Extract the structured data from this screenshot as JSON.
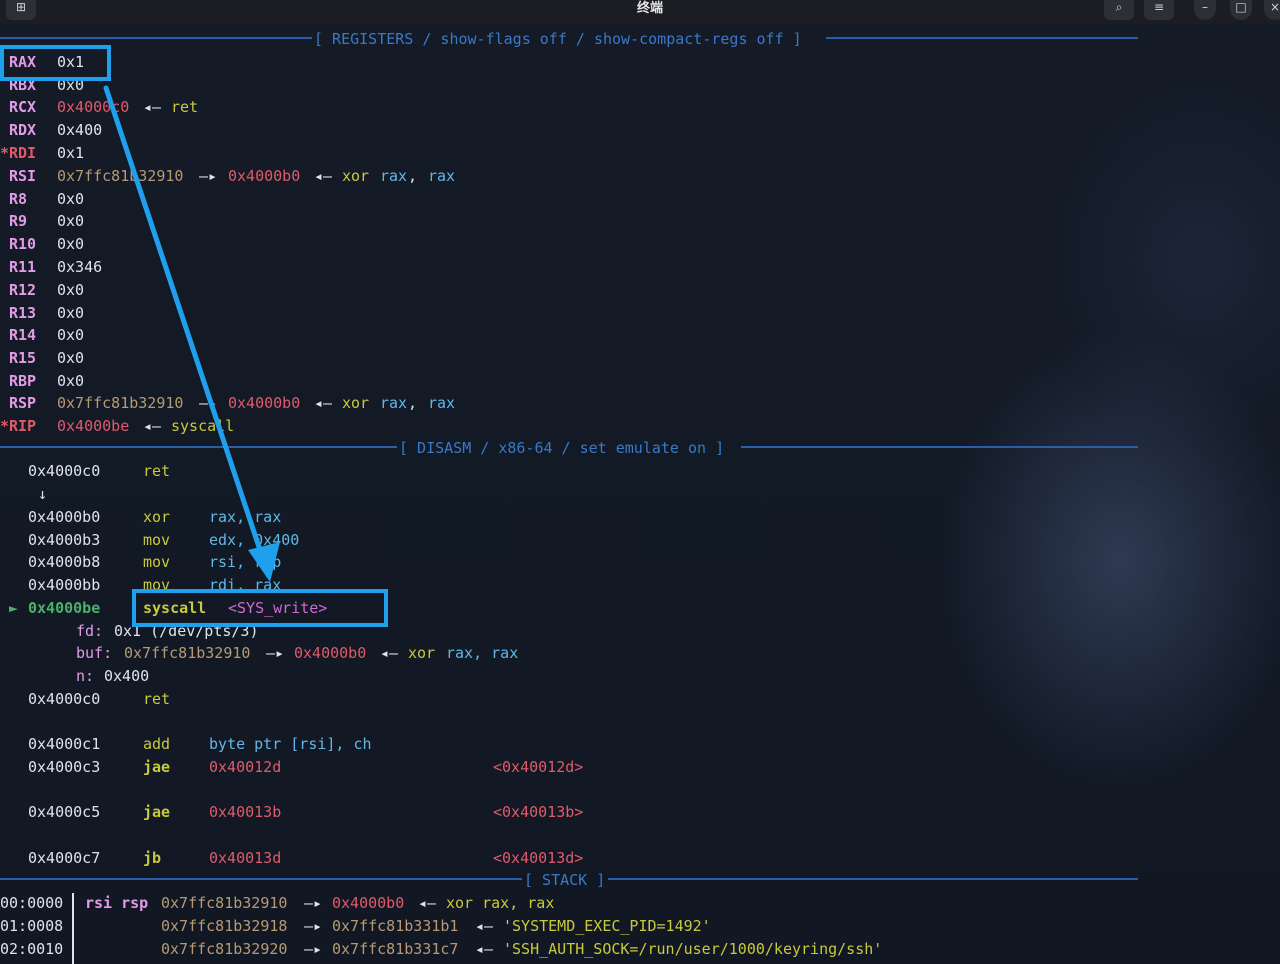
{
  "window": {
    "title": "终端",
    "new_tab_icon": "⊞",
    "search_icon": "⌕",
    "menu_icon": "≡",
    "minimize_icon": "–",
    "maximize_icon": "□",
    "close_icon": "×"
  },
  "headers": {
    "registers": "[ REGISTERS / show-flags off / show-compact-regs off ]",
    "disasm": "[ DISASM / x86-64 / set emulate on ]",
    "stack": "[ STACK ]"
  },
  "registers": [
    {
      "mark": "",
      "name": "RAX",
      "value": "0x1",
      "extra": ""
    },
    {
      "mark": "",
      "name": "RBX",
      "value": "0x0",
      "extra": ""
    },
    {
      "mark": "",
      "name": "RCX",
      "value": "0x4000c0",
      "arrow": "◂—",
      "extra": "ret"
    },
    {
      "mark": "",
      "name": "RDX",
      "value": "0x400",
      "extra": ""
    },
    {
      "mark": "*",
      "name": "RDI",
      "value": "0x1",
      "extra": ""
    },
    {
      "mark": "",
      "name": "RSI",
      "value": "0x7ffc81b32910",
      "arrow": "—▸",
      "target": "0x4000b0",
      "arrow2": "◂—",
      "ins": "xor",
      "ops": [
        "rax",
        "rax"
      ]
    },
    {
      "mark": "",
      "name": "R8",
      "value": "0x0",
      "extra": ""
    },
    {
      "mark": "",
      "name": "R9",
      "value": "0x0",
      "extra": ""
    },
    {
      "mark": "",
      "name": "R10",
      "value": "0x0",
      "extra": ""
    },
    {
      "mark": "",
      "name": "R11",
      "value": "0x346",
      "extra": ""
    },
    {
      "mark": "",
      "name": "R12",
      "value": "0x0",
      "extra": ""
    },
    {
      "mark": "",
      "name": "R13",
      "value": "0x0",
      "extra": ""
    },
    {
      "mark": "",
      "name": "R14",
      "value": "0x0",
      "extra": ""
    },
    {
      "mark": "",
      "name": "R15",
      "value": "0x0",
      "extra": ""
    },
    {
      "mark": "",
      "name": "RBP",
      "value": "0x0",
      "extra": ""
    },
    {
      "mark": "",
      "name": "RSP",
      "value": "0x7ffc81b32910",
      "arrow": "—▸",
      "target": "0x4000b0",
      "arrow2": "◂—",
      "ins": "xor",
      "ops": [
        "rax",
        "rax"
      ]
    },
    {
      "mark": "*",
      "name": "RIP",
      "value": "0x4000be",
      "arrow": "◂—",
      "extra": "syscall"
    }
  ],
  "disasm": [
    {
      "addr": "0x4000c0",
      "mn": "ret",
      "ops": ""
    },
    {
      "down_arrow": "↓"
    },
    {
      "addr": "0x4000b0",
      "mn": "xor",
      "ops": "rax, rax"
    },
    {
      "addr": "0x4000b3",
      "mn": "mov",
      "ops": "edx, 0x400"
    },
    {
      "addr": "0x4000b8",
      "mn": "mov",
      "ops": "rsi, rsp"
    },
    {
      "addr": "0x4000bb",
      "mn": "mov",
      "ops": "rdi, rax"
    },
    {
      "pointer": "►",
      "addr": "0x4000be",
      "mn": "syscall",
      "sym": "<SYS_write>"
    },
    {
      "arg": "fd:",
      "val": "0x1 (/dev/pts/3)"
    },
    {
      "arg": "buf:",
      "val": "0x7ffc81b32910",
      "arrow": "—▸",
      "target": "0x4000b0",
      "arrow2": "◂—",
      "ins": "xor",
      "ops": "rax, rax"
    },
    {
      "arg": "n:",
      "val": "0x400"
    },
    {
      "addr": "0x4000c0",
      "mn": "ret",
      "ops": ""
    },
    {
      "addr": "0x4000c1",
      "mn": "add",
      "ops": "byte ptr [rsi], ch"
    },
    {
      "addr": "0x4000c3",
      "mn": "jae",
      "target": "0x40012d",
      "label": "<0x40012d>"
    },
    {
      "addr": "0x4000c5",
      "mn": "jae",
      "target": "0x40013b",
      "label": "<0x40013b>"
    },
    {
      "addr": "0x4000c7",
      "mn": "jb",
      "target": "0x40013d",
      "label": "<0x40013d>"
    }
  ],
  "stack": [
    {
      "off": "00:0000",
      "regs": "rsi rsp",
      "addr": "0x7ffc81b32910",
      "arrow": "—▸",
      "target": "0x4000b0",
      "arrow2": "◂—",
      "val": "xor rax, rax"
    },
    {
      "off": "01:0008",
      "regs": "",
      "addr": "0x7ffc81b32918",
      "arrow": "—▸",
      "target": "0x7ffc81b331b1",
      "arrow2": "◂—",
      "val": "'SYSTEMD_EXEC_PID=1492'"
    },
    {
      "off": "02:0010",
      "regs": "",
      "addr": "0x7ffc81b32920",
      "arrow": "—▸",
      "target": "0x7ffc81b331c7",
      "arrow2": "◂—",
      "val": "'SSH_AUTH_SOCK=/run/user/1000/keyring/ssh'"
    }
  ],
  "annotation": {
    "color": "#1ea0ec"
  }
}
